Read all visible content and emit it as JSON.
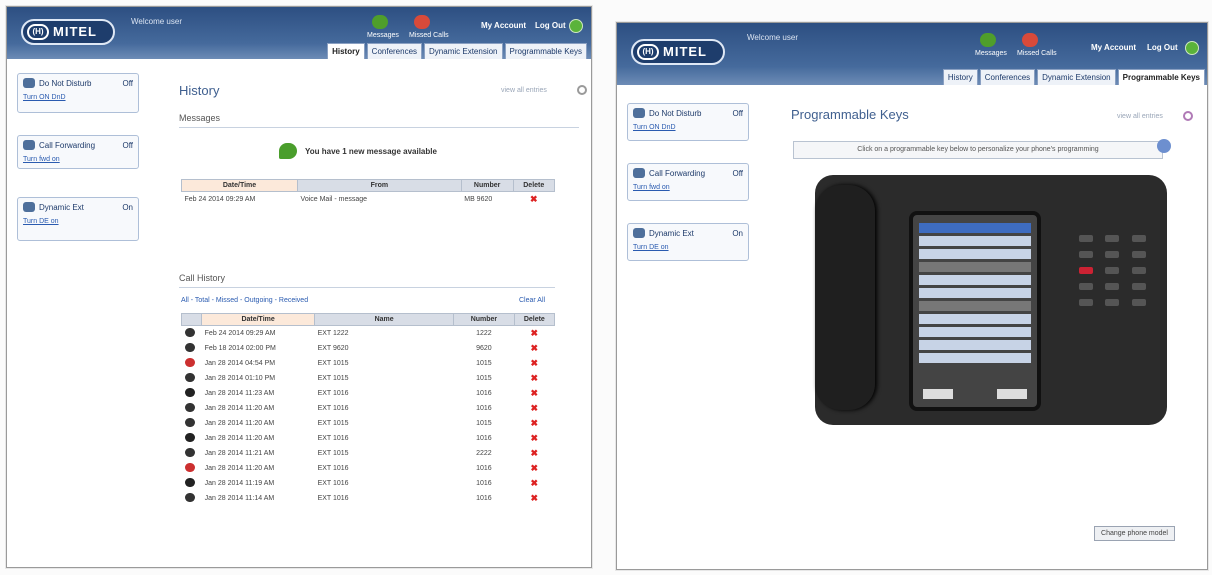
{
  "header": {
    "logo": "MITEL",
    "logo_mark": "(H)",
    "welcome": "Welcome user",
    "messages_label": "Messages",
    "missed_calls_label": "Missed Calls",
    "my_account": "My Account",
    "log_out": "Log Out"
  },
  "tabs": [
    "History",
    "Conferences",
    "Dynamic Extension",
    "Programmable Keys"
  ],
  "sidebar": [
    {
      "label": "Do Not Disturb",
      "state": "Off",
      "link": "Turn ON DnD"
    },
    {
      "label": "Call Forwarding",
      "state": "Off",
      "link": "Turn fwd on"
    },
    {
      "label": "Dynamic Ext",
      "state": "On",
      "link": "Turn DE on"
    }
  ],
  "history": {
    "title": "History",
    "messages_section": "Messages",
    "notice": "You have 1 new message available",
    "msg_headers": [
      "Date/Time",
      "From",
      "Number",
      "Delete"
    ],
    "msg_rows": [
      {
        "date": "Feb 24 2014 09:29 AM",
        "from": "Voice Mail - message",
        "number": "MB 9620"
      }
    ],
    "call_section": "Call History",
    "filters": "All - Total - Missed - Outgoing - Received",
    "clear_all": "Clear All",
    "call_headers": [
      "Date/Time",
      "Name",
      "Number",
      "Delete"
    ],
    "call_rows": [
      {
        "type": "in",
        "date": "Feb 24 2014 09:29 AM",
        "name": "EXT 1222",
        "number": "1222"
      },
      {
        "type": "in",
        "date": "Feb 18 2014 02:00 PM",
        "name": "EXT 9620",
        "number": "9620"
      },
      {
        "type": "missed",
        "date": "Jan 28 2014 04:54 PM",
        "name": "EXT 1015",
        "number": "1015"
      },
      {
        "type": "in",
        "date": "Jan 28 2014 01:10 PM",
        "name": "EXT 1015",
        "number": "1015"
      },
      {
        "type": "out",
        "date": "Jan 28 2014 11:23 AM",
        "name": "EXT 1016",
        "number": "1016"
      },
      {
        "type": "in",
        "date": "Jan 28 2014 11:20 AM",
        "name": "EXT 1016",
        "number": "1016"
      },
      {
        "type": "in",
        "date": "Jan 28 2014 11:20 AM",
        "name": "EXT 1015",
        "number": "1015"
      },
      {
        "type": "out",
        "date": "Jan 28 2014 11:20 AM",
        "name": "EXT 1016",
        "number": "1016"
      },
      {
        "type": "in",
        "date": "Jan 28 2014 11:21 AM",
        "name": "EXT 1015",
        "number": "2222"
      },
      {
        "type": "missed",
        "date": "Jan 28 2014 11:20 AM",
        "name": "EXT 1016",
        "number": "1016"
      },
      {
        "type": "out",
        "date": "Jan 28 2014 11:19 AM",
        "name": "EXT 1016",
        "number": "1016"
      },
      {
        "type": "in",
        "date": "Jan 28 2014 11:14 AM",
        "name": "EXT 1016",
        "number": "1016"
      }
    ],
    "view_all": "view all entries"
  },
  "keys": {
    "title": "Programmable Keys",
    "hint": "Click on a programmable key below to personalize your phone's programming",
    "change_button": "Change phone model",
    "view_link": "view all entries"
  }
}
